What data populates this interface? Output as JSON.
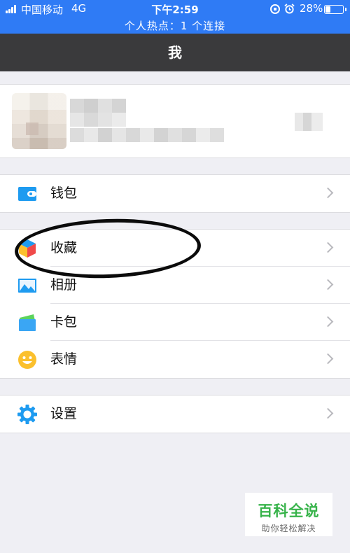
{
  "status_bar": {
    "carrier": "中国移动",
    "network": "4G",
    "time": "下午2:59",
    "battery": "28%",
    "battery_level": 0.28,
    "hotspot": "个人热点：1 个连接"
  },
  "nav": {
    "title": "我"
  },
  "menu": {
    "wallet": "钱包",
    "favorites": "收藏",
    "album": "相册",
    "card_pack": "卡包",
    "stickers": "表情",
    "settings": "设置"
  },
  "colors": {
    "status_bar": "#2f7bf5",
    "nav_bar": "#3a3a3c",
    "icon_blue": "#1e9bf0",
    "emoji_yellow": "#fbc02d",
    "watermark_green": "#37b34a"
  },
  "icons": {
    "wallet": "wallet-icon",
    "favorites": "favorites-cube-icon",
    "album": "album-icon",
    "card_pack": "card-pack-icon",
    "stickers": "smiley-icon",
    "settings": "gear-icon"
  },
  "watermark": {
    "title": "百科全说",
    "subtitle": "助你轻松解决"
  }
}
